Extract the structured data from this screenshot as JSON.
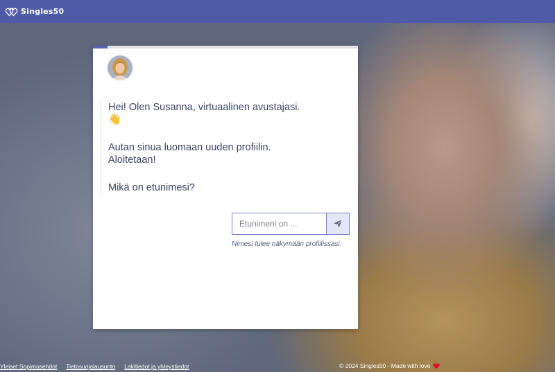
{
  "brand": {
    "name": "Singles50"
  },
  "chat": {
    "progress_fraction": 0.055,
    "assistant_avatar": "assistant-avatar",
    "messages": {
      "greeting_line": "Hei! Olen Susanna, virtuaalinen avustajasi.",
      "greeting_emoji": "👋",
      "intro_line1": "Autan sinua luomaan uuden profiilin.",
      "intro_line2": "Aloitetaan!",
      "question": "Mikä on etunimesi?"
    },
    "input": {
      "placeholder": "Etunimeni on ...",
      "value": ""
    },
    "send_icon": "paper-plane-icon",
    "hint": "Nimesi tulee näkymään profiilissasi."
  },
  "footer": {
    "links": [
      "Yleiset Sopimusehdot",
      "Tietosuojalausunto",
      "Lakitiedot ja yhteystiedot"
    ],
    "copyright": "© 2024 Singles50 - Made with love",
    "heart_icon": "heart-icon"
  },
  "colors": {
    "topbar": "#4f5aa8",
    "accent": "#5563b5",
    "text": "#3a4266",
    "heart": "#e0102a"
  }
}
